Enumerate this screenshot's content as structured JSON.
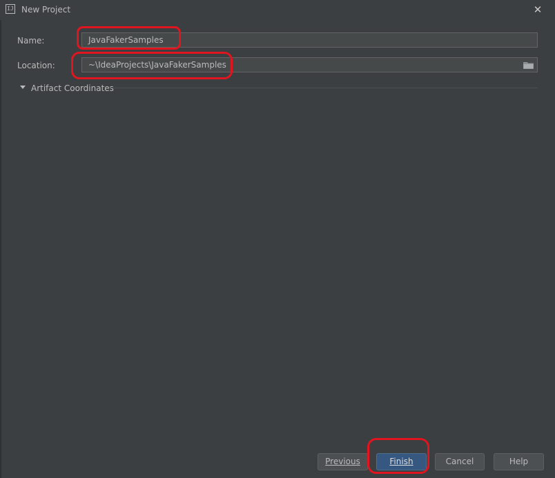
{
  "window": {
    "title": "New Project",
    "app_icon_text": "IJ",
    "close_label": "✕"
  },
  "form": {
    "name_label": "Name:",
    "name_value": "JavaFakerSamples",
    "location_label": "Location:",
    "location_value": "~\\IdeaProjects\\JavaFakerSamples",
    "artifact_section_label": "Artifact Coordinates",
    "artifact_section_expanded": false
  },
  "buttons": {
    "previous": "Previous",
    "finish": "Finish",
    "cancel": "Cancel",
    "help": "Help"
  },
  "colors": {
    "background": "#3c3f41",
    "input_background": "#45494a",
    "primary_button": "#365880",
    "highlight_annotation": "#e0151f"
  },
  "icons": [
    "app-icon",
    "close-icon",
    "folder-icon",
    "expand-triangle-icon"
  ]
}
